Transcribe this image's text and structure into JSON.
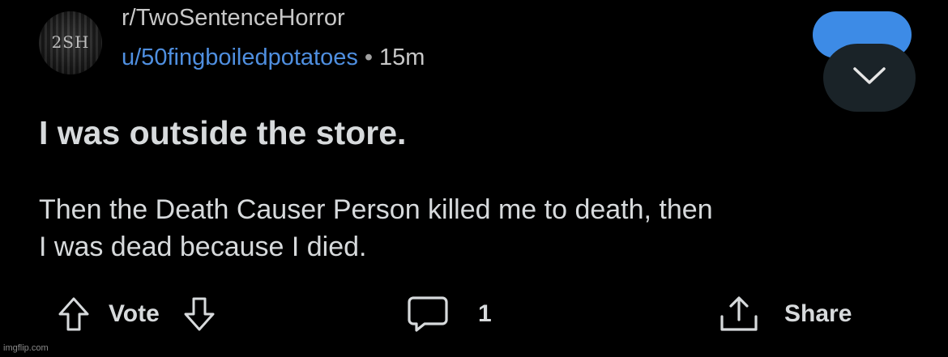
{
  "post": {
    "subreddit": "r/TwoSentenceHorror",
    "username": "u/50fingboiledpotatoes",
    "separator": "•",
    "time_ago": "15m",
    "avatar_text": "2SH",
    "title": "I was outside the store.",
    "body_line1": "Then the Death Causer Person killed me to death, then",
    "body_line2": "I was dead because I died."
  },
  "actions": {
    "vote_label": "Vote",
    "comment_count": "1",
    "share_label": "Share"
  },
  "icons": {
    "upvote": "arrow-up-icon",
    "downvote": "arrow-down-icon",
    "comment": "comment-bubble-icon",
    "share": "share-icon",
    "expand": "chevron-down-icon"
  },
  "colors": {
    "background": "#000000",
    "text": "#d7dadc",
    "username": "#4f8fe0",
    "join_pill": "#3d8be6",
    "expand_button": "#1a2328"
  },
  "watermark": "imgflip.com"
}
